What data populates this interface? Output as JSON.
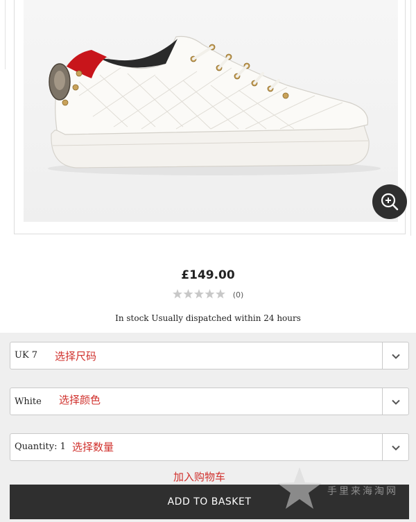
{
  "product": {
    "image_icon": "white-quilted-sneaker-with-red-heel-and-eagle-badge",
    "zoom_icon": "zoom-in-icon",
    "price": "£149.00",
    "rating": {
      "stars": 0,
      "max": 5,
      "count_label": "(0)"
    },
    "stock_text": "In stock Usually dispatched within 24 hours"
  },
  "options": {
    "size": {
      "value": "UK 7",
      "note": "选择尺码",
      "icon": "chevron-down-icon"
    },
    "color": {
      "value": "White",
      "note": "选择颜色",
      "icon": "chevron-down-icon"
    },
    "quantity": {
      "value": "Quantity: 1",
      "note": "选择数量",
      "icon": "chevron-down-icon"
    }
  },
  "basket": {
    "note": "加入购物车",
    "button_label": "ADD TO BASKET"
  },
  "watermark": {
    "text": "手里来海淘网",
    "icon": "star-logo"
  },
  "colors": {
    "dark_button": "#2f2f2f",
    "annotation_red": "#d0312d",
    "star_empty": "#c8c8c8"
  }
}
